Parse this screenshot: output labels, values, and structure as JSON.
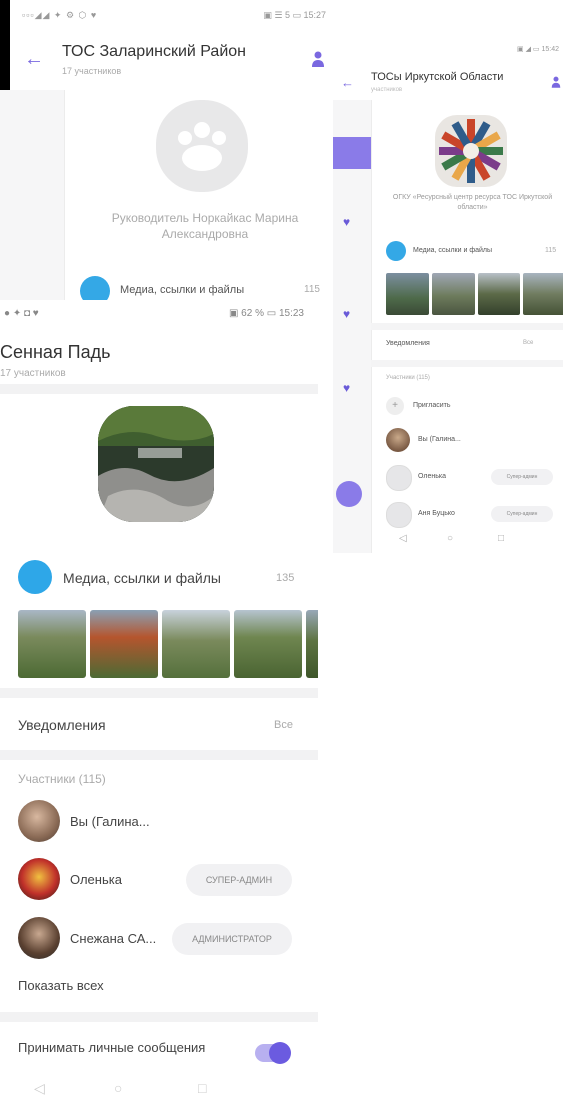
{
  "screenA": {
    "status_left": "▫▫▫◢◢ ✦ ⚙ ⬡ ♥",
    "status_right": "▣ ☰ 5 ▭ 15:27",
    "title": "ТОС Заларинский Район",
    "subtitle": "17 участников",
    "description": "Руководитель Норкайкас Марина Александровна",
    "media_label": "Медиа, ссылки и файлы",
    "media_count": "115"
  },
  "screenB": {
    "status_right": "▣ ◢ ▭ 15:42",
    "title": "ТОСы Иркутской Области",
    "subtitle": "участников",
    "description": "ОГКУ «Ресурсный центр ресурса ТОС Иркутской области»",
    "media_label": "Медиа, ссылки и файлы",
    "media_count": "115",
    "notifications_label": "Уведомления",
    "notifications_value": "Все",
    "members_header": "Участники (115)",
    "invite_label": "Пригласить",
    "members": [
      {
        "name": "Вы (Галина...",
        "role": ""
      },
      {
        "name": "Оленька",
        "role": "Супер-админ"
      },
      {
        "name": "Аня Буцько",
        "role": "Супер-админ"
      }
    ]
  },
  "screenC": {
    "status_left": "● ✦ ◘ ♥",
    "status_right": "▣ 62 % ▭ 15:23",
    "title": "Сенная Падь",
    "subtitle": "17 участников",
    "media_label": "Медиа, ссылки и файлы",
    "media_count": "135",
    "notifications_label": "Уведомления",
    "notifications_value": "Все",
    "members_header": "Участники (115)",
    "members": [
      {
        "name": "Вы (Галина...",
        "role": ""
      },
      {
        "name": "Оленька",
        "role": "СУПЕР-АДМИН"
      },
      {
        "name": "Снежана СА...",
        "role": "АДМИНИСТРАТОР"
      }
    ],
    "show_all": "Показать всех",
    "private_messages_label": "Принимать личные сообщения",
    "private_messages_enabled": true,
    "nav": [
      "◁",
      "○",
      "□"
    ]
  },
  "colors": {
    "accent": "#6b5be0",
    "media_icon": "#2ea7e8",
    "divider": "#f2f2f3"
  }
}
